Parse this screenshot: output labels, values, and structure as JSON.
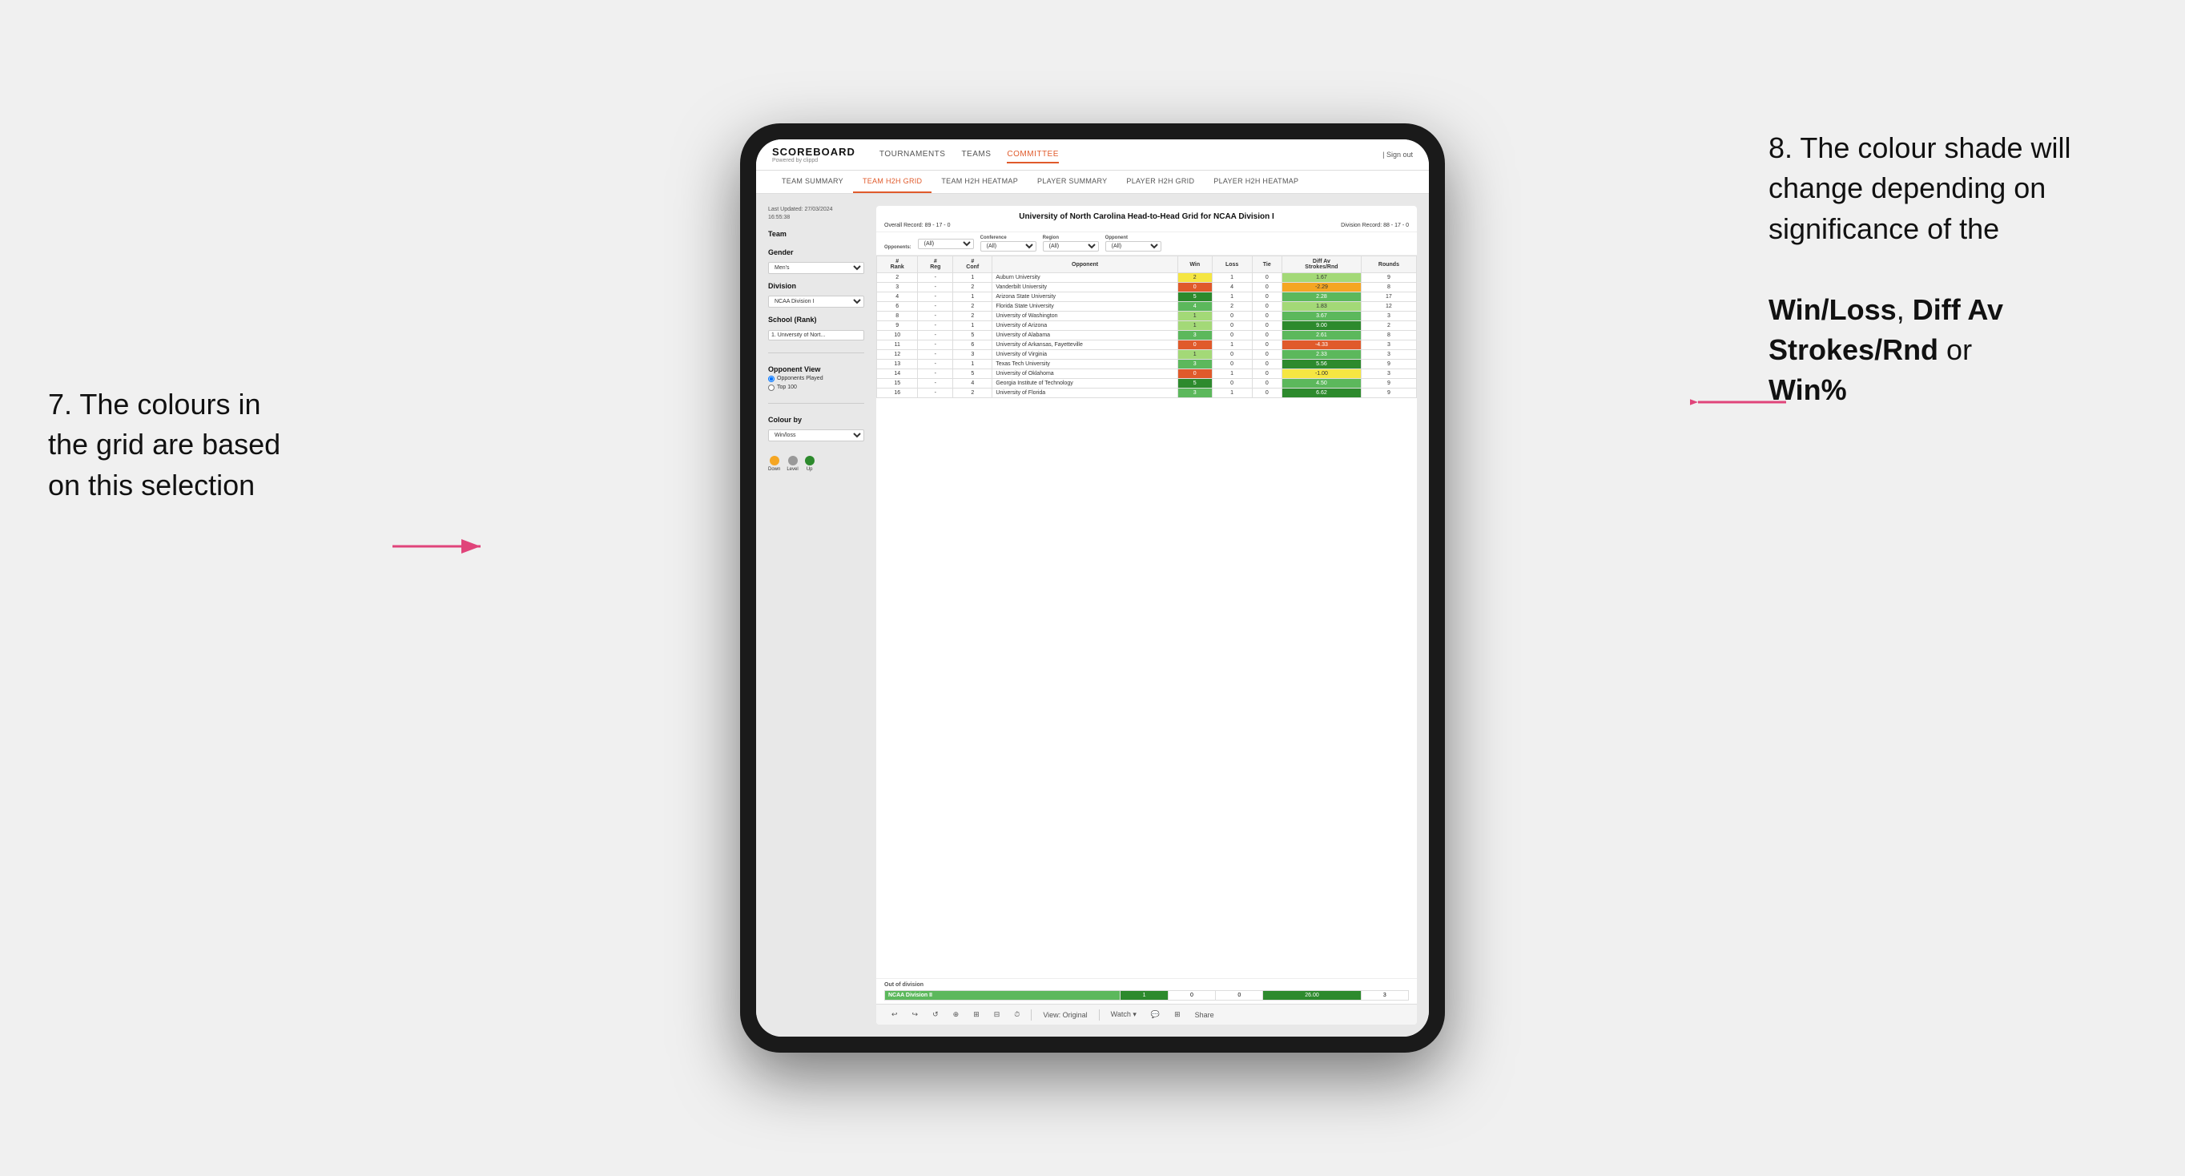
{
  "annotations": {
    "left_title": "7. The colours in the grid are based on this selection",
    "right_title": "8. The colour shade will change depending on significance of the",
    "right_bold1": "Win/Loss",
    "right_comma": ", ",
    "right_bold2": "Diff Av Strokes/Rnd",
    "right_or": " or",
    "right_bold3": "Win%"
  },
  "header": {
    "logo": "SCOREBOARD",
    "logo_sub": "Powered by clippd",
    "nav_items": [
      "TOURNAMENTS",
      "TEAMS",
      "COMMITTEE"
    ],
    "sign_out": "Sign out",
    "active_nav": "COMMITTEE"
  },
  "sub_nav": {
    "items": [
      "TEAM SUMMARY",
      "TEAM H2H GRID",
      "TEAM H2H HEATMAP",
      "PLAYER SUMMARY",
      "PLAYER H2H GRID",
      "PLAYER H2H HEATMAP"
    ],
    "active": "TEAM H2H GRID"
  },
  "left_panel": {
    "last_updated_label": "Last Updated: 27/03/2024",
    "last_updated_time": "16:55:38",
    "team_label": "Team",
    "gender_label": "Gender",
    "gender_value": "Men's",
    "division_label": "Division",
    "division_value": "NCAA Division I",
    "school_label": "School (Rank)",
    "school_value": "1. University of Nort...",
    "opponent_view_label": "Opponent View",
    "opponents_played_label": "Opponents Played",
    "top100_label": "Top 100",
    "colour_by_label": "Colour by",
    "colour_by_value": "Win/loss",
    "legend_down": "Down",
    "legend_level": "Level",
    "legend_up": "Up"
  },
  "grid": {
    "title": "University of North Carolina Head-to-Head Grid for NCAA Division I",
    "overall_record": "Overall Record: 89 - 17 - 0",
    "division_record": "Division Record: 88 - 17 - 0",
    "filters": {
      "opponents_label": "Opponents:",
      "opponents_value": "(All)",
      "conference_label": "Conference",
      "conference_value": "(All)",
      "region_label": "Region",
      "region_value": "(All)",
      "opponent_label": "Opponent",
      "opponent_value": "(All)"
    },
    "columns": [
      "#\nRank",
      "#\nReg",
      "#\nConf",
      "Opponent",
      "Win",
      "Loss",
      "Tie",
      "Diff Av\nStrokes/Rnd",
      "Rounds"
    ],
    "rows": [
      {
        "rank": "2",
        "reg": "-",
        "conf": "1",
        "opponent": "Auburn University",
        "win": "2",
        "loss": "1",
        "tie": "0",
        "diff": "1.67",
        "rounds": "9",
        "win_color": "yellow",
        "diff_color": "green_light"
      },
      {
        "rank": "3",
        "reg": "-",
        "conf": "2",
        "opponent": "Vanderbilt University",
        "win": "0",
        "loss": "4",
        "tie": "0",
        "diff": "-2.29",
        "rounds": "8",
        "win_color": "red",
        "diff_color": "orange"
      },
      {
        "rank": "4",
        "reg": "-",
        "conf": "1",
        "opponent": "Arizona State University",
        "win": "5",
        "loss": "1",
        "tie": "0",
        "diff": "2.28",
        "rounds": "17",
        "win_color": "green_dark",
        "diff_color": "green_med"
      },
      {
        "rank": "6",
        "reg": "-",
        "conf": "2",
        "opponent": "Florida State University",
        "win": "4",
        "loss": "2",
        "tie": "0",
        "diff": "1.83",
        "rounds": "12",
        "win_color": "green_med",
        "diff_color": "green_light"
      },
      {
        "rank": "8",
        "reg": "-",
        "conf": "2",
        "opponent": "University of Washington",
        "win": "1",
        "loss": "0",
        "tie": "0",
        "diff": "3.67",
        "rounds": "3",
        "win_color": "green_light",
        "diff_color": "green_med"
      },
      {
        "rank": "9",
        "reg": "-",
        "conf": "1",
        "opponent": "University of Arizona",
        "win": "1",
        "loss": "0",
        "tie": "0",
        "diff": "9.00",
        "rounds": "2",
        "win_color": "green_light",
        "diff_color": "green_dark"
      },
      {
        "rank": "10",
        "reg": "-",
        "conf": "5",
        "opponent": "University of Alabama",
        "win": "3",
        "loss": "0",
        "tie": "0",
        "diff": "2.61",
        "rounds": "8",
        "win_color": "green_med",
        "diff_color": "green_med"
      },
      {
        "rank": "11",
        "reg": "-",
        "conf": "6",
        "opponent": "University of Arkansas, Fayetteville",
        "win": "0",
        "loss": "1",
        "tie": "0",
        "diff": "-4.33",
        "rounds": "3",
        "win_color": "red",
        "diff_color": "red"
      },
      {
        "rank": "12",
        "reg": "-",
        "conf": "3",
        "opponent": "University of Virginia",
        "win": "1",
        "loss": "0",
        "tie": "0",
        "diff": "2.33",
        "rounds": "3",
        "win_color": "green_light",
        "diff_color": "green_med"
      },
      {
        "rank": "13",
        "reg": "-",
        "conf": "1",
        "opponent": "Texas Tech University",
        "win": "3",
        "loss": "0",
        "tie": "0",
        "diff": "5.56",
        "rounds": "9",
        "win_color": "green_med",
        "diff_color": "green_dark"
      },
      {
        "rank": "14",
        "reg": "-",
        "conf": "5",
        "opponent": "University of Oklahoma",
        "win": "0",
        "loss": "1",
        "tie": "0",
        "diff": "-1.00",
        "rounds": "3",
        "win_color": "red",
        "diff_color": "yellow"
      },
      {
        "rank": "15",
        "reg": "-",
        "conf": "4",
        "opponent": "Georgia Institute of Technology",
        "win": "5",
        "loss": "0",
        "tie": "0",
        "diff": "4.50",
        "rounds": "9",
        "win_color": "green_dark",
        "diff_color": "green_med"
      },
      {
        "rank": "16",
        "reg": "-",
        "conf": "2",
        "opponent": "University of Florida",
        "win": "3",
        "loss": "1",
        "tie": "0",
        "diff": "6.62",
        "rounds": "9",
        "win_color": "green_med",
        "diff_color": "green_dark"
      }
    ],
    "out_of_division_label": "Out of division",
    "out_of_division_row": {
      "name": "NCAA Division II",
      "win": "1",
      "loss": "0",
      "tie": "0",
      "diff": "26.00",
      "rounds": "3",
      "color": "green_dark"
    }
  },
  "toolbar": {
    "view_label": "View: Original",
    "watch_label": "Watch ▾",
    "share_label": "Share"
  }
}
